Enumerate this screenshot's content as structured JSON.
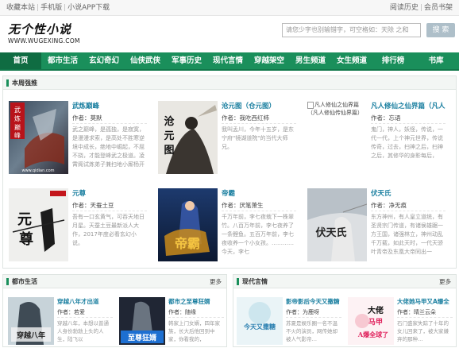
{
  "topbar": {
    "links": [
      "收藏本站",
      "手机版",
      "小说APP下载"
    ],
    "right_links": [
      "阅读历史",
      "会员书架"
    ]
  },
  "logo": {
    "title": "无个性小说",
    "url": "WWW.WUGEXING.COM"
  },
  "search": {
    "placeholder": "请您少字也别输错字，可空格如：天除 之和",
    "button": "搜 索"
  },
  "nav": [
    "首页",
    "都市生活",
    "玄幻奇幻",
    "仙侠武侠",
    "军事历史",
    "现代言情",
    "穿越架空",
    "男生频道",
    "女生频道",
    "排行榜",
    "书库"
  ],
  "recommend": {
    "title": "本周强推",
    "books": [
      {
        "title": "武炼巅峰",
        "author": "作者：莫默",
        "desc": "武之巅峰，是孤独，是寂寞，是漫漫求索，是高处不胜寒逆境中成长，绝地中崛起，不屈不挠，才能登峰武之极道。凌霄阁试炼弟子兼扫地小厮杨开偶",
        "cover_text": "武炼巅峰",
        "cover_sub": "www.qidian.com"
      },
      {
        "title": "沧元图（仓元图）",
        "author": "作者：我吃西红柿",
        "desc": "我叫孟川，今年十五岁，是东宁府\"镜湖道院\"的当代大师兄。",
        "cover_text": "沧元图",
        "cover_sub": ""
      },
      {
        "title": "凡人修仙之仙界篇（凡人",
        "author": "作者：忘语",
        "desc": "鬼门，神人，妖怪，传说，一代一代，上个神元世界，传说传奇，过去，扫神之后，扫神之后，其修华的身影每后，",
        "broken_alt": "凡人修仙之仙界篇（凡人修仙传仙界篇）"
      },
      {
        "title": "元尊",
        "author": "作者：天蚕土豆",
        "desc": "吾有一口玄黄气，可吞天地日月星。天蚕土豆最新派人大作，2017年度必看玄幻小说。",
        "cover_text": "元尊",
        "cover_sub": ""
      },
      {
        "title": "帝霸",
        "author": "作者：厌笔萧生",
        "desc": "千万年前，李七夜栽下一株翠竹。八百万年前，李七夜养了一条鲤鱼。五百万年前，李七夜收养一个小女孩。…………今天，李七",
        "cover_text": "帝霸",
        "cover_sub": ""
      },
      {
        "title": "伏天氏",
        "author": "作者：净无痕",
        "desc": "东方神州，有人皇立道统，有圣贤宗门传道，有诸侯雄踞一方王国，诸强林立，神州动乱千万载，如此天时，一代天骄叶青帝及东凰大帝同出一",
        "cover_text": "伏天氏",
        "cover_sub": ""
      }
    ]
  },
  "sections": [
    {
      "title": "都市生活",
      "more": "更多",
      "books": [
        {
          "title": "穿越八年才出道",
          "author": "作者：若爱",
          "desc": "穿越八年，本想以普通人身份勃勃上头的人生，陆飞以",
          "cover_text": "穿越八年才出道"
        },
        {
          "title": "都市之至尊狂婿",
          "author": "作者：随缘",
          "desc": "韩家上门女婿，四年家族，长大后他回到中家，你看我的，",
          "cover_text": "至尊狂婿"
        }
      ]
    },
    {
      "title": "现代言情",
      "more": "更多",
      "books": [
        {
          "title": "影帝影后今天又撒糖",
          "author": "作者：为鹿呀",
          "desc": "苏夏是娱乐圈一名不温不火的演员，网传她却被人气影帝…",
          "cover_text": "今天又撒糖"
        },
        {
          "title": "大佬她马甲又A爆全",
          "author": "作者：晴兰云朵",
          "desc": "石门盛家失踪了十年的女儿回来了，被大家嫌弃的那种…",
          "cover_text": "大佬她马甲又A爆全球了"
        }
      ]
    }
  ]
}
